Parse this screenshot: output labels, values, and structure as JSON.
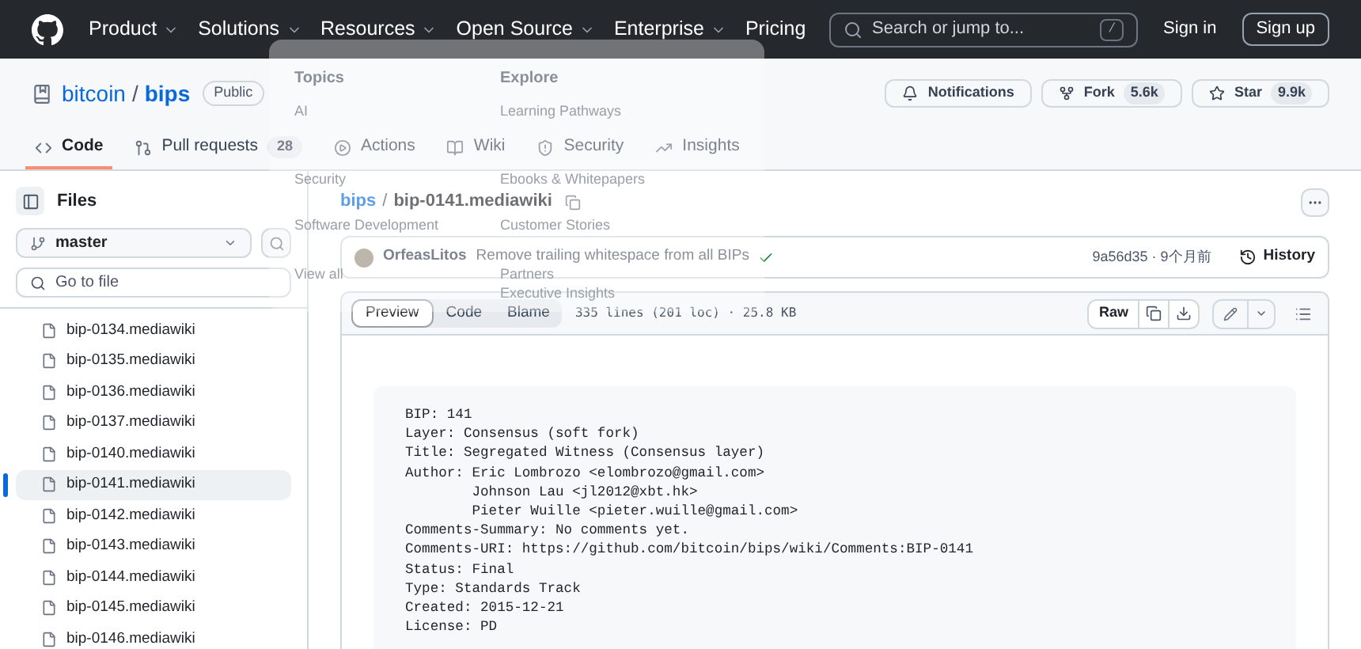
{
  "header": {
    "nav": [
      {
        "label": "Product",
        "dropdown": true
      },
      {
        "label": "Solutions",
        "dropdown": true
      },
      {
        "label": "Resources",
        "dropdown": true
      },
      {
        "label": "Open Source",
        "dropdown": true
      },
      {
        "label": "Enterprise",
        "dropdown": true
      },
      {
        "label": "Pricing",
        "dropdown": false
      }
    ],
    "search": {
      "placeholder": "Search or jump to...",
      "shortcut": "/"
    },
    "sign_in": "Sign in",
    "sign_up": "Sign up"
  },
  "menu": {
    "columns": [
      {
        "heading": "Topics",
        "items": [
          "AI",
          "Security",
          "Software Development",
          "View all"
        ]
      },
      {
        "heading": "Explore",
        "items": [
          "Learning Pathways",
          "Ebooks & Whitepapers",
          "Customer Stories",
          "Partners",
          "Executive Insights"
        ]
      }
    ]
  },
  "repo": {
    "owner": "bitcoin",
    "separator": "/",
    "name": "bips",
    "visibility": "Public",
    "actions": [
      {
        "kind": "notifications",
        "label": "Notifications"
      },
      {
        "kind": "fork",
        "label": "Fork",
        "count": "5.6k"
      },
      {
        "kind": "star",
        "label": "Star",
        "count": "9.9k"
      }
    ],
    "tabs": [
      {
        "kind": "code",
        "label": "Code",
        "selected": true
      },
      {
        "kind": "pulls",
        "label": "Pull requests",
        "count": "28",
        "selected": false
      },
      {
        "kind": "actions",
        "label": "Actions",
        "selected": false
      },
      {
        "kind": "wiki",
        "label": "Wiki",
        "selected": false
      },
      {
        "kind": "security",
        "label": "Security",
        "selected": false
      },
      {
        "kind": "insights",
        "label": "Insights",
        "selected": false
      }
    ]
  },
  "sidebar": {
    "title": "Files",
    "branch": "master",
    "filter": {
      "placeholder": "Go to file"
    },
    "files": [
      {
        "name": "bip-0134.mediawiki",
        "selected": false
      },
      {
        "name": "bip-0135.mediawiki",
        "selected": false
      },
      {
        "name": "bip-0136.mediawiki",
        "selected": false
      },
      {
        "name": "bip-0137.mediawiki",
        "selected": false
      },
      {
        "name": "bip-0140.mediawiki",
        "selected": false
      },
      {
        "name": "bip-0141.mediawiki",
        "selected": true
      },
      {
        "name": "bip-0142.mediawiki",
        "selected": false
      },
      {
        "name": "bip-0143.mediawiki",
        "selected": false
      },
      {
        "name": "bip-0144.mediawiki",
        "selected": false
      },
      {
        "name": "bip-0145.mediawiki",
        "selected": false
      },
      {
        "name": "bip-0146.mediawiki",
        "selected": false
      }
    ]
  },
  "breadcrumb": {
    "repo": "bips",
    "separator": "/",
    "file": "bip-0141.mediawiki"
  },
  "commit": {
    "author": "OrfeasLitos",
    "message": "Remove trailing whitespace from all BIPs",
    "check": true,
    "sha": "9a56d35 · 9个月前",
    "history": "History"
  },
  "file_view": {
    "tabs": [
      {
        "label": "Preview",
        "selected": true
      },
      {
        "label": "Code",
        "selected": false
      },
      {
        "label": "Blame",
        "selected": false
      }
    ],
    "stats": "335 lines (201 loc) · 25.8 KB",
    "raw": "Raw",
    "lines": [
      "BIP: 141",
      "Layer: Consensus (soft fork)",
      "Title: Segregated Witness (Consensus layer)",
      "Author: Eric Lombrozo <elombrozo@gmail.com>",
      "        Johnson Lau <jl2012@xbt.hk>",
      "        Pieter Wuille <pieter.wuille@gmail.com>",
      "Comments-Summary: No comments yet.",
      "Comments-URI: https://github.com/bitcoin/bips/wiki/Comments:BIP-0141",
      "Status: Final",
      "Type: Standards Track",
      "Created: 2015-12-21",
      "License: PD"
    ]
  }
}
